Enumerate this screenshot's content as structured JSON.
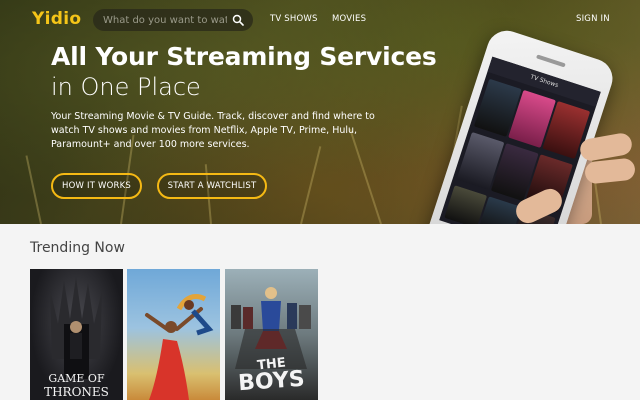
{
  "nav": {
    "logo": "Yidio",
    "search_placeholder": "What do you want to watch?",
    "links": [
      "TV SHOWS",
      "MOVIES"
    ],
    "sign_in": "SIGN IN"
  },
  "hero": {
    "title_line1": "All Your Streaming Services",
    "title_line2": "in One Place",
    "description": "Your Streaming Movie & TV Guide. Track, discover and find where to watch TV shows and movies from Netflix, Apple TV, Prime, Hulu, Paramount+ and over 100 more services.",
    "buttons": [
      "HOW IT WORKS",
      "START A WATCHLIST"
    ],
    "phone_header": "TV Shows"
  },
  "trending": {
    "title": "Trending Now",
    "items": [
      {
        "title_line1": "GAME OF",
        "title_line2": "THRONES"
      },
      {
        "title": ""
      },
      {
        "title_line1": "THE",
        "title_line2": "BOYS"
      }
    ]
  },
  "colors": {
    "accent": "#f5c518",
    "button_border": "#f5b914",
    "page_bg": "#f4f4f4"
  }
}
